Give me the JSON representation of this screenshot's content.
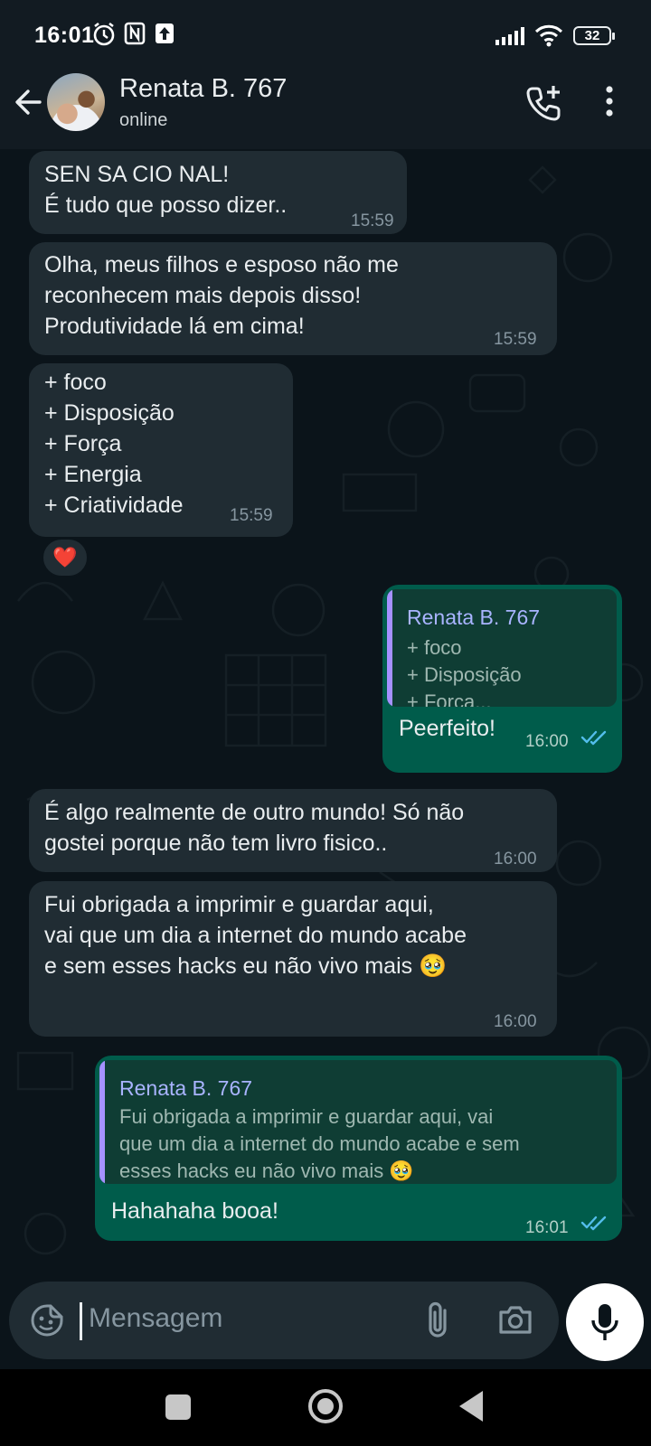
{
  "status_bar": {
    "time": "16:01",
    "battery": "32",
    "icons": [
      "alarm-icon",
      "nfc-icon",
      "upload-icon",
      "signal-icon",
      "wifi-icon",
      "battery-icon"
    ]
  },
  "header": {
    "contact_name": "Renata B. 767",
    "status": "online",
    "icons": [
      "back-arrow-icon",
      "add-call-icon",
      "more-vertical-icon"
    ]
  },
  "messages": [
    {
      "direction": "incoming",
      "text": "SEN SA CIO NAL!\nÉ tudo que posso dizer..",
      "time": "15:59"
    },
    {
      "direction": "incoming",
      "text": "Olha, meus filhos e esposo não me\nreconhecem mais depois disso!\nProdutividade lá em cima!",
      "time": "15:59"
    },
    {
      "direction": "incoming",
      "text": "+ foco\n+ Disposição\n+ Força\n+ Energia\n+ Criatividade",
      "time": "15:59",
      "reaction": "❤️"
    },
    {
      "direction": "outgoing",
      "quote": {
        "author": "Renata B. 767",
        "text": "+ foco\n+ Disposição\n+ Força..."
      },
      "text": "Peerfeito!",
      "time": "16:00",
      "status": "read"
    },
    {
      "direction": "incoming",
      "text": "É algo realmente de outro mundo! Só não\ngostei porque não tem livro fisico..",
      "time": "16:00"
    },
    {
      "direction": "incoming",
      "text": "Fui obrigada a imprimir e guardar aqui,\nvai que um dia a internet do mundo acabe\ne sem esses hacks eu não vivo mais 🥹",
      "time": "16:00"
    },
    {
      "direction": "outgoing",
      "quote": {
        "author": "Renata B. 767",
        "text": "Fui obrigada a imprimir e guardar aqui, vai\nque um dia a internet do mundo acabe e sem\nesses hacks eu não vivo mais 🥹"
      },
      "text": "Hahahaha booa!",
      "time": "16:01",
      "status": "read"
    }
  ],
  "composer": {
    "placeholder": "Mensagem",
    "icons": [
      "sticker-icon",
      "attach-icon",
      "camera-icon",
      "mic-icon"
    ]
  },
  "colors": {
    "background": "#0b141a",
    "incoming_bubble": "#202c33",
    "outgoing_bubble": "#005c4b",
    "read_ticks": "#53bdeb",
    "quote_accent": "#a591ff"
  }
}
